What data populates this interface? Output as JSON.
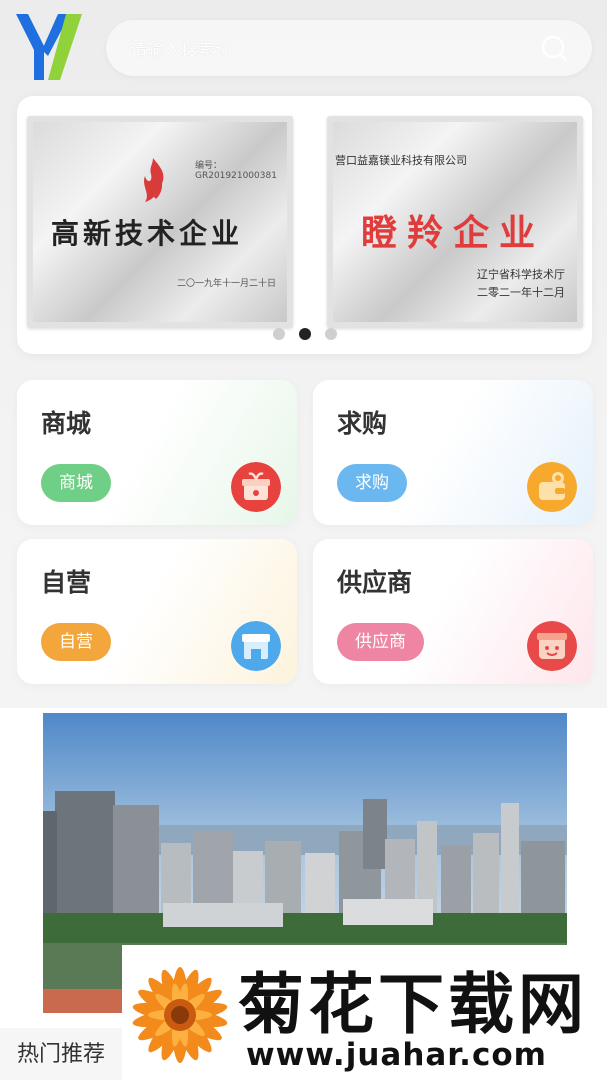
{
  "search": {
    "placeholder": "请输入搜索词",
    "icon": "search-icon"
  },
  "banner": {
    "certificates": [
      {
        "title": "高新技术企业",
        "number": "编号：GR201921000381",
        "date": "二〇一九年十一月二十日"
      },
      {
        "company": "营口益嘉镁业科技有限公司",
        "title": "瞪羚企业",
        "issuer": "辽宁省科学技术厅",
        "date": "二零二一年十二月"
      }
    ],
    "active_index": 1,
    "dot_count": 3
  },
  "cards": [
    {
      "title": "商城",
      "button": "商城",
      "color": "#6fcf86",
      "icon": "gift-box-icon"
    },
    {
      "title": "求购",
      "button": "求购",
      "color": "#6bb8f0",
      "icon": "wallet-icon"
    },
    {
      "title": "自营",
      "button": "自营",
      "color": "#f3a63b",
      "icon": "store-icon"
    },
    {
      "title": "供应商",
      "button": "供应商",
      "color": "#ee85a2",
      "icon": "supplier-icon"
    }
  ],
  "section": {
    "hot_title": "热门推荐"
  },
  "watermark": {
    "title": "菊花下载网",
    "url": "www.juahar.com"
  }
}
